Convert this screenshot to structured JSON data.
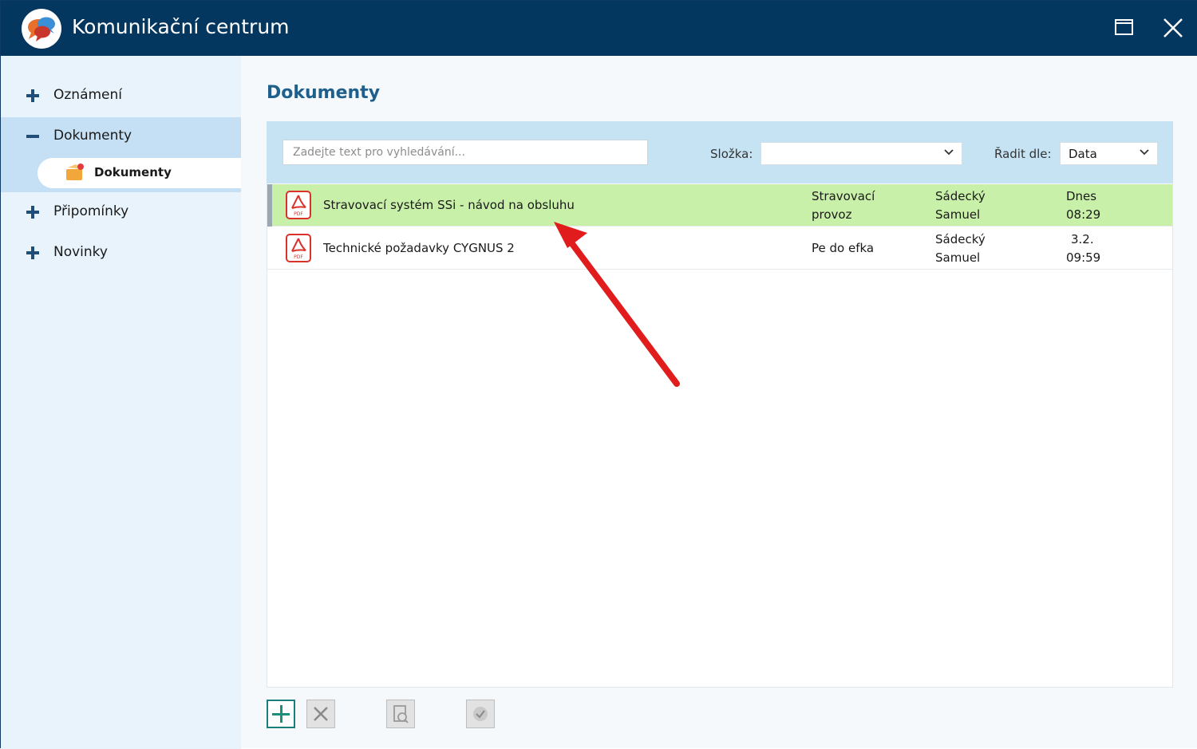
{
  "window": {
    "title": "Komunikační centrum",
    "icons": [
      "chat-bubbles-logo-icon",
      "maximize-icon",
      "close-icon"
    ]
  },
  "sidebar": {
    "items": [
      {
        "label": "Oznámení",
        "expanded": false
      },
      {
        "label": "Dokumenty",
        "expanded": true
      },
      {
        "label": "Připomínky",
        "expanded": false
      },
      {
        "label": "Novinky",
        "expanded": false
      }
    ],
    "subitem": {
      "label": "Dokumenty",
      "icon": "folder-envelope-icon"
    }
  },
  "main": {
    "title": "Dokumenty",
    "search": {
      "placeholder": "Zadejte text pro vyhledávání...",
      "value": ""
    },
    "folder": {
      "label": "Složka:",
      "value": ""
    },
    "sort": {
      "label": "Řadit dle:",
      "value": "Data"
    },
    "documents": [
      {
        "name": "Stravovací systém SSi - návod na obsluhu",
        "folder_line1": "Stravovací",
        "folder_line2": "provoz",
        "author_line1": "Sádecký",
        "author_line2": "Samuel",
        "date_line1": "Dnes",
        "date_line2": "08:29",
        "selected": true
      },
      {
        "name": "Technické požadavky CYGNUS 2",
        "folder_line1": "Pe do efka",
        "folder_line2": "",
        "author_line1": "Sádecký",
        "author_line2": "Samuel",
        "date_line1": "3.2.",
        "date_line2": "09:59",
        "selected": false
      }
    ]
  },
  "footer": {
    "buttons": [
      "add-icon",
      "delete-icon",
      "preview-icon",
      "confirm-icon"
    ]
  },
  "colors": {
    "titlebar": "#04375f",
    "selected_row": "#c8f0a8",
    "accent": "#1f5f8b",
    "annotation_arrow": "#e01c1c"
  }
}
